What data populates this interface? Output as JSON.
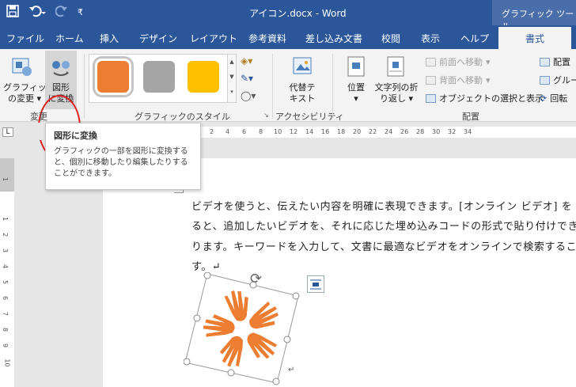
{
  "window": {
    "title": "アイコン.docx  -  Word",
    "context_tab_group": "グラフィック ツール"
  },
  "qat": {
    "save_icon": "save-icon",
    "undo_icon": "undo-icon",
    "redo_icon": "redo-icon",
    "customize_icon": "customize-qat-icon"
  },
  "tabs": [
    {
      "label": "ファイル"
    },
    {
      "label": "ホーム"
    },
    {
      "label": "挿入"
    },
    {
      "label": "デザイン"
    },
    {
      "label": "レイアウト"
    },
    {
      "label": "参考資料"
    },
    {
      "label": "差し込み文書"
    },
    {
      "label": "校閲"
    },
    {
      "label": "表示"
    },
    {
      "label": "ヘルプ"
    },
    {
      "label": "書式",
      "active": true
    }
  ],
  "ribbon": {
    "change_group": {
      "label": "変更",
      "change_graphic": "グラフィック\nの変更 ▾",
      "convert_to_shape": "図形\nに変換"
    },
    "styles_group": {
      "label": "グラフィックのスタイル",
      "swatches": [
        "#ed7d31",
        "#a5a5a5",
        "#ffc000"
      ]
    },
    "accessibility_group": {
      "label": "アクセシビリティ",
      "alt_text": "代替テ\nキスト"
    },
    "arrange_group": {
      "label": "配置",
      "position": "位置\n▾",
      "wrap_text": "文字列の折\nり返し ▾",
      "bring_forward": "前面へ移動",
      "send_backward": "背面へ移動",
      "selection_pane": "オブジェクトの選択と表示",
      "align": "配置",
      "group": "グルー",
      "rotate": "回転"
    }
  },
  "tooltip": {
    "title": "図形に変換",
    "description": "グラフィックの一部を図形に変換すると、個別に移動したり編集したりすることができます。"
  },
  "ruler": {
    "top_numbers": [
      "2",
      "4",
      "6",
      "8",
      "10",
      "12",
      "14",
      "16",
      "18",
      "20",
      "22",
      "24",
      "26",
      "28",
      "30",
      "32",
      "34"
    ],
    "left_numbers": [
      "1",
      "1",
      "2",
      "3",
      "4",
      "5",
      "6",
      "7",
      "8",
      "9",
      "10"
    ]
  },
  "document": {
    "lines": [
      "ビデオを使うと、伝えたい内容を明確に表現できます。[オンライン ビデオ] を",
      "ると、追加したいビデオを、それに応じた埋め込みコードの形式で貼り付けでき",
      "ります。キーワードを入力して、文書に最適なビデオをオンラインで検索するこ",
      "す。↵"
    ],
    "graphic_name": "hands-circle-icon",
    "graphic_color": "#ed7d31",
    "end_mark": "↵"
  },
  "colors": {
    "title_bar": "#2b579a",
    "ribbon_bg": "#f3f3f3",
    "highlight_circle": "#e02020"
  }
}
